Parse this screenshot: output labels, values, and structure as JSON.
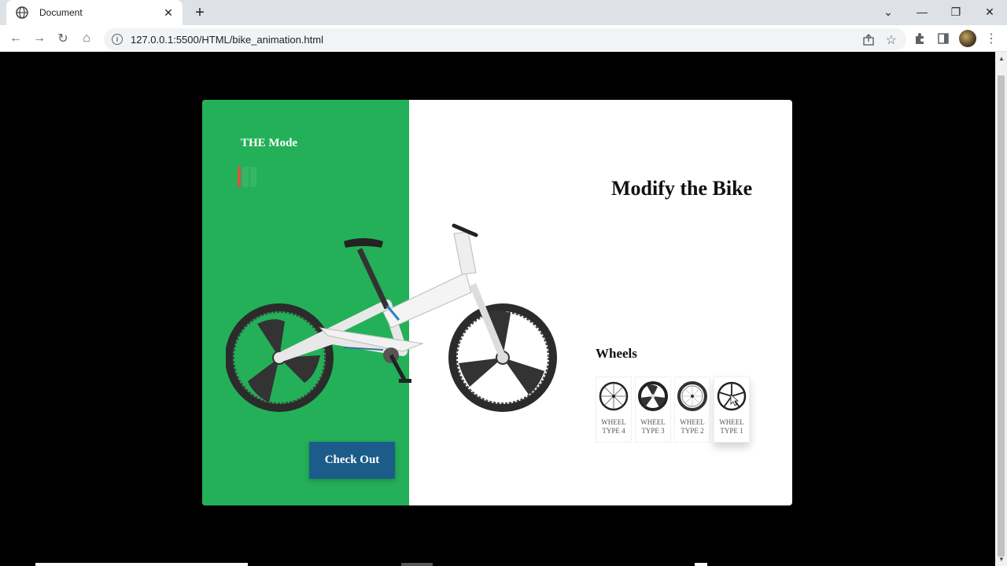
{
  "browser": {
    "tab_title": "Document",
    "new_tab": "+",
    "url": "127.0.0.1:5500/HTML/bike_animation.html"
  },
  "page": {
    "mode_label": "THE Mode",
    "heading": "Modify the Bike",
    "checkout_label": "Check Out",
    "wheels_title": "Wheels",
    "wheel_options": [
      {
        "label": "WHEEL TYPE 4",
        "selected": false
      },
      {
        "label": "WHEEL TYPE 3",
        "selected": false
      },
      {
        "label": "WHEEL TYPE 2",
        "selected": false
      },
      {
        "label": "WHEEL TYPE 1",
        "selected": true
      }
    ],
    "colors": {
      "panel_green": "#23b058",
      "button_blue": "#1b5c8a",
      "indicator_red": "#d9533c"
    }
  }
}
